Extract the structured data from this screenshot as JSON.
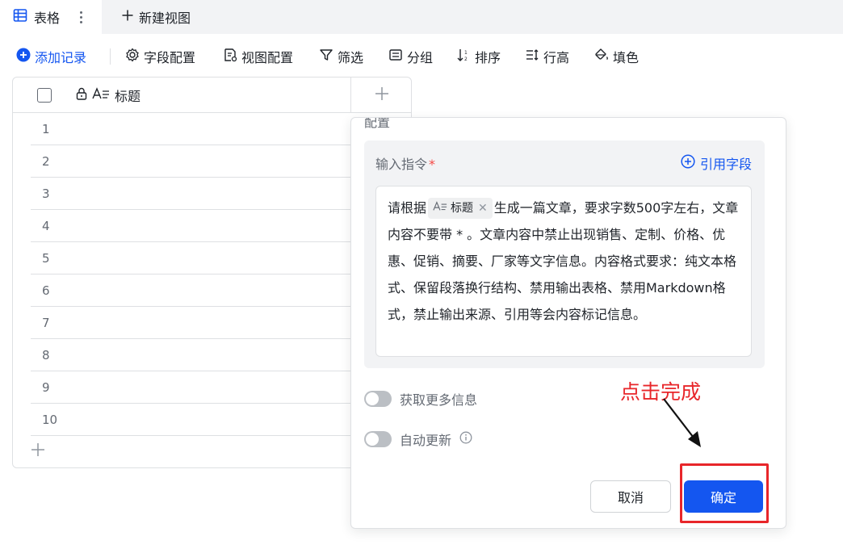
{
  "tabs": {
    "active_label": "表格",
    "new_view_label": "新建视图"
  },
  "toolbar": {
    "add_record": "添加记录",
    "field_config": "字段配置",
    "view_config": "视图配置",
    "filter": "筛选",
    "group": "分组",
    "sort": "排序",
    "row_height": "行高",
    "fill_color": "填色"
  },
  "grid": {
    "title_column": "标题",
    "rows": [
      "1",
      "2",
      "3",
      "4",
      "5",
      "6",
      "7",
      "8",
      "9",
      "10"
    ]
  },
  "panel": {
    "heading": "配置",
    "instruction_label": "输入指令",
    "required_mark": "*",
    "reference_field": "引用字段",
    "instruction_prefix": "请根据",
    "instruction_chip": "标题",
    "instruction_rest": "生成一篇文章，要求字数500字左右，文章内容不要带 * 。文章内容中禁止出现销售、定制、价格、优惠、促销、摘要、厂家等文字信息。内容格式要求：纯文本格式、保留段落换行结构、禁用输出表格、禁用Markdown格式，禁止输出来源、引用等会内容标记信息。",
    "toggle_more_info": "获取更多信息",
    "toggle_auto_update": "自动更新",
    "cancel": "取消",
    "confirm": "确定"
  },
  "annotation": {
    "text": "点击完成",
    "color": "#e8262a"
  },
  "colors": {
    "primary": "#1456f0",
    "danger": "#f54a45"
  }
}
